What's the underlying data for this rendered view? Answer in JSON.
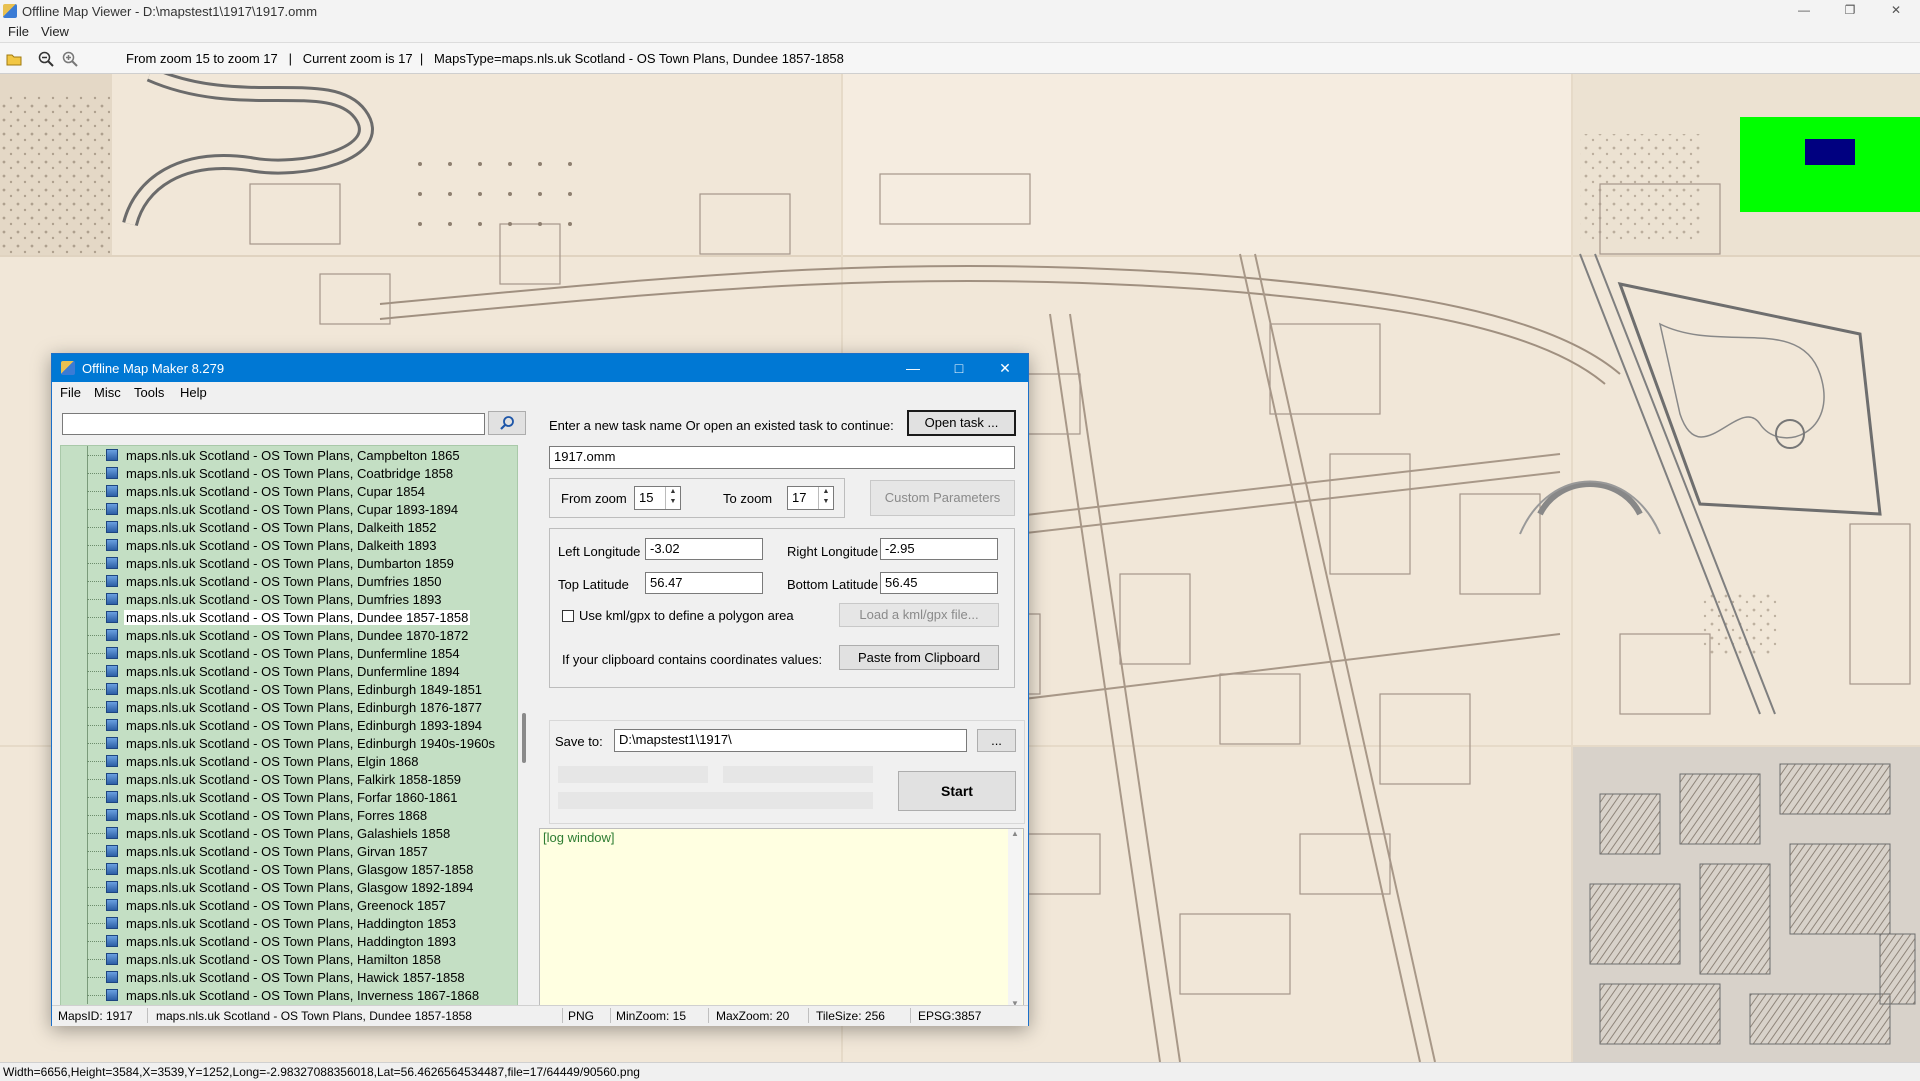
{
  "viewer": {
    "title": "Offline Map Viewer - D:\\mapstest1\\1917\\1917.omm",
    "menu": [
      "File",
      "View"
    ],
    "toolbar_status": "From zoom 15 to zoom 17   |   Current zoom is 17  |   MapsType=maps.nls.uk Scotland - OS Town Plans, Dundee 1857-1858",
    "statusbar": "Width=6656,Height=3584,X=3539,Y=1252,Long=-2.98327088356018,Lat=56.4626564534487,file=17/64449/90560.png",
    "icons": [
      "open-folder-icon",
      "zoom-out-icon",
      "zoom-in-icon"
    ]
  },
  "dialog": {
    "title": "Offline Map Maker 8.279",
    "menu": [
      "File",
      "Misc",
      "Tools",
      "Help"
    ],
    "search": {
      "value": ""
    },
    "task_prompt": "Enter a new task name Or open an existed task to continue:",
    "open_task_label": "Open task ...",
    "task_name": "1917.omm",
    "from_zoom_label": "From zoom",
    "from_zoom": "15",
    "to_zoom_label": "To zoom",
    "to_zoom": "17",
    "custom_params_label": "Custom Parameters",
    "left_lon_label": "Left Longitude",
    "left_lon": "-3.02",
    "right_lon_label": "Right Longitude",
    "right_lon": "-2.95",
    "top_lat_label": "Top Latitude",
    "top_lat": "56.47",
    "bottom_lat_label": "Bottom Latitude",
    "bottom_lat": "56.45",
    "kml_checkbox_label": "Use kml/gpx to define a polygon area",
    "load_kml_label": "Load a kml/gpx file...",
    "clipboard_text": "If your clipboard contains coordinates values:",
    "paste_label": "Paste from Clipboard",
    "save_to_label": "Save to:",
    "save_to": "D:\\mapstest1\\1917\\",
    "browse_label": "...",
    "start_label": "Start",
    "log_text": "[log window]",
    "tree_items": [
      "maps.nls.uk Scotland - OS Town Plans, Campbelton 1865",
      "maps.nls.uk Scotland - OS Town Plans, Coatbridge 1858",
      "maps.nls.uk Scotland - OS Town Plans, Cupar 1854",
      "maps.nls.uk Scotland - OS Town Plans, Cupar 1893-1894",
      "maps.nls.uk Scotland - OS Town Plans, Dalkeith 1852",
      "maps.nls.uk Scotland - OS Town Plans, Dalkeith 1893",
      "maps.nls.uk Scotland - OS Town Plans, Dumbarton 1859",
      "maps.nls.uk Scotland - OS Town Plans, Dumfries 1850",
      "maps.nls.uk Scotland - OS Town Plans, Dumfries 1893",
      "maps.nls.uk Scotland - OS Town Plans, Dundee 1857-1858",
      "maps.nls.uk Scotland - OS Town Plans, Dundee 1870-1872",
      "maps.nls.uk Scotland - OS Town Plans, Dunfermline 1854",
      "maps.nls.uk Scotland - OS Town Plans, Dunfermline 1894",
      "maps.nls.uk Scotland - OS Town Plans, Edinburgh 1849-1851",
      "maps.nls.uk Scotland - OS Town Plans, Edinburgh 1876-1877",
      "maps.nls.uk Scotland - OS Town Plans, Edinburgh 1893-1894",
      "maps.nls.uk Scotland - OS Town Plans, Edinburgh 1940s-1960s",
      "maps.nls.uk Scotland - OS Town Plans, Elgin 1868",
      "maps.nls.uk Scotland - OS Town Plans, Falkirk 1858-1859",
      "maps.nls.uk Scotland - OS Town Plans, Forfar 1860-1861",
      "maps.nls.uk Scotland - OS Town Plans, Forres 1868",
      "maps.nls.uk Scotland - OS Town Plans, Galashiels 1858",
      "maps.nls.uk Scotland - OS Town Plans, Girvan 1857",
      "maps.nls.uk Scotland - OS Town Plans, Glasgow 1857-1858",
      "maps.nls.uk Scotland - OS Town Plans, Glasgow 1892-1894",
      "maps.nls.uk Scotland - OS Town Plans, Greenock 1857",
      "maps.nls.uk Scotland - OS Town Plans, Haddington 1853",
      "maps.nls.uk Scotland - OS Town Plans, Haddington 1893",
      "maps.nls.uk Scotland - OS Town Plans, Hamilton 1858",
      "maps.nls.uk Scotland - OS Town Plans, Hawick 1857-1858",
      "maps.nls.uk Scotland - OS Town Plans, Inverness 1867-1868"
    ],
    "selected_index": 9,
    "status": {
      "maps_id": "MapsID: 1917",
      "maps_name": "maps.nls.uk Scotland - OS Town Plans, Dundee 1857-1858",
      "format": "PNG",
      "min_zoom": "MinZoom: 15",
      "max_zoom": "MaxZoom: 20",
      "tile_size": "TileSize: 256",
      "epsg": "EPSG:3857"
    }
  },
  "colors": {
    "titlebar_accent": "#0078d4",
    "tree_bg": "#c4dfc4",
    "log_bg": "#ffffe1",
    "map_paper": "#efe4d4",
    "overlay_green": "#00ff00",
    "overlay_navy": "#000080"
  }
}
